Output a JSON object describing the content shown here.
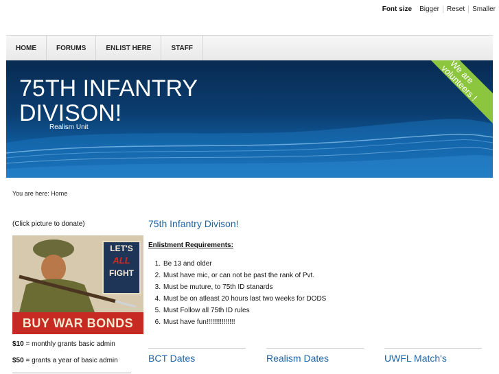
{
  "font_size": {
    "label": "Font size",
    "bigger": "Bigger",
    "reset": "Reset",
    "smaller": "Smaller"
  },
  "nav": {
    "items": [
      "HOME",
      "FORUMS",
      "ENLIST HERE",
      "STAFF"
    ]
  },
  "banner": {
    "title_line1": "75TH INFANTRY",
    "title_line2": "DIVISON!",
    "subtitle": "Realism Unit",
    "ribbon_line1": "We are",
    "ribbon_line2": "volunteers !",
    "ribbon_color": "#8cc63f"
  },
  "breadcrumb": "You are here: Home",
  "sidebar": {
    "donate_label": "(Click picture to donate)",
    "poster_top_line1": "LET'S",
    "poster_top_line2": "ALL",
    "poster_top_line3": "FIGHT",
    "poster_bottom": "BUY WAR BONDS",
    "admin1_amount": "$10",
    "admin1_text": " = monthly grants basic admin",
    "admin2_amount": "$50",
    "admin2_text": " = grants a year of basic admin"
  },
  "main": {
    "title": "75th Infantry Divison!",
    "requirements_heading": "Enlistment Requirements:",
    "requirements": [
      "Be 13 and older",
      "Must have mic, or can not be past the rank of Pvt.",
      "Must be muture, to 75th ID stanards",
      "Must be on atleast 20 hours last two weeks for DODS",
      "Must Follow all 75th ID rules",
      "Must have fun!!!!!!!!!!!!!!!"
    ],
    "sections": [
      "BCT Dates",
      "Realism Dates",
      "UWFL Match's"
    ]
  },
  "colors": {
    "link_blue": "#1f64a6",
    "banner_dark": "#082b52"
  }
}
